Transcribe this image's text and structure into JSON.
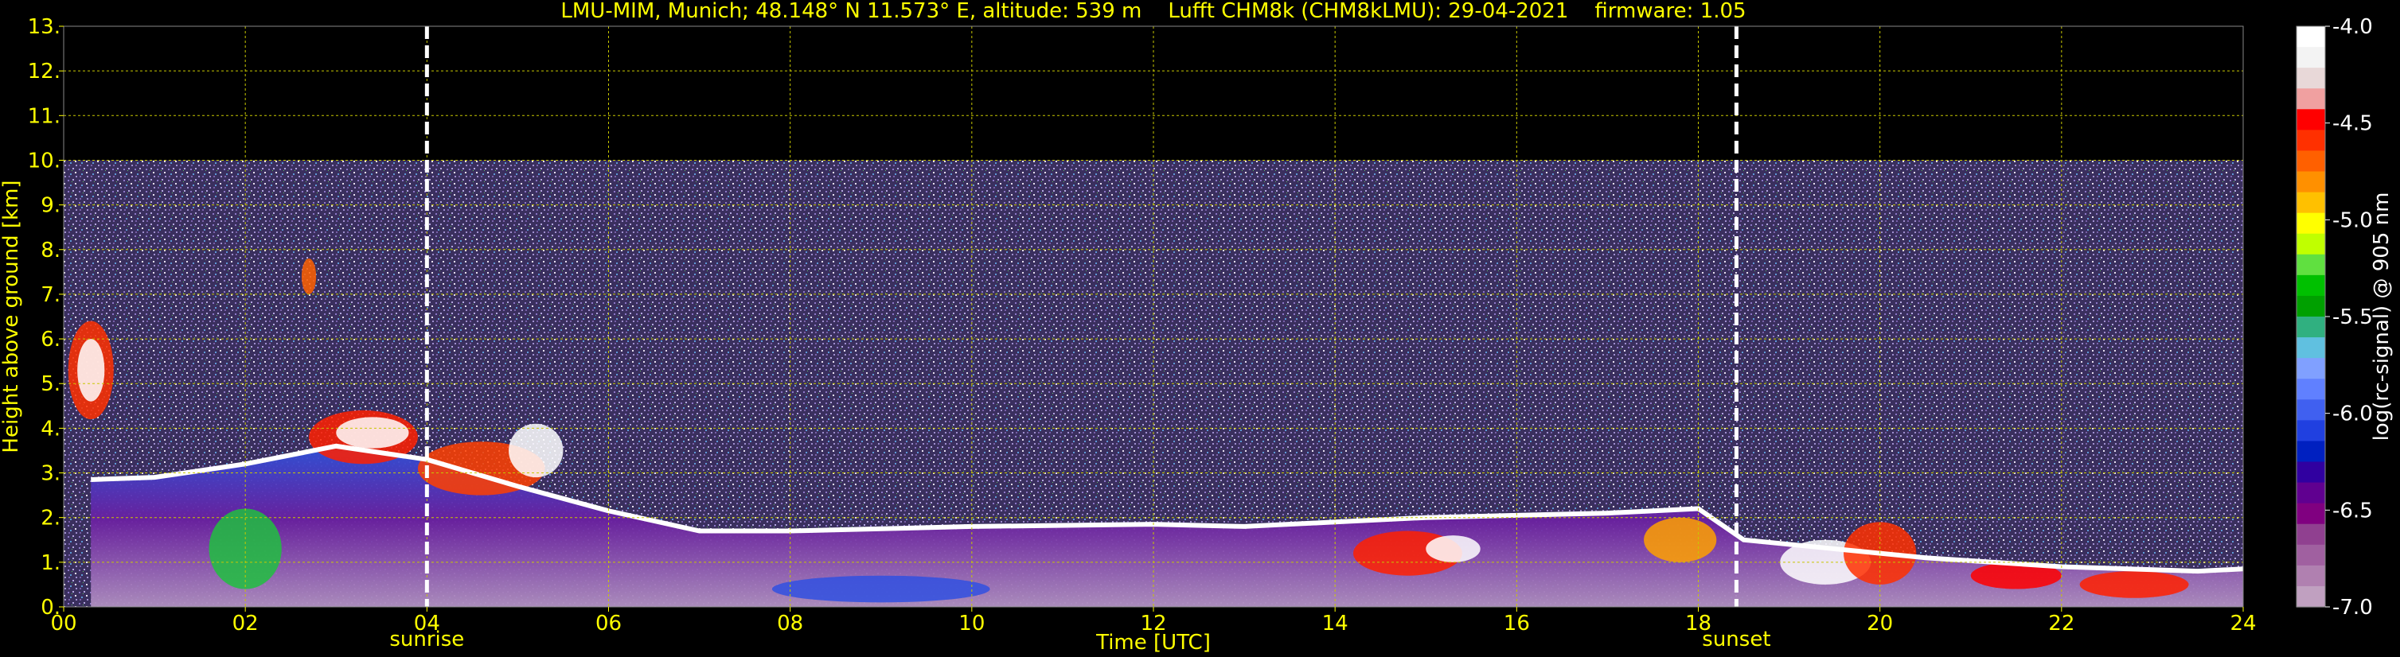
{
  "chart_data": {
    "type": "heatmap",
    "title": "LMU-MIM, Munich; 48.148° N 11.573° E, altitude: 539 m    Lufft CHM8k (CHM8kLMU): 29-04-2021    firmware: 1.05",
    "xlabel": "Time [UTC]",
    "ylabel": "Height above ground [km]",
    "xlim": [
      0,
      24
    ],
    "ylim": [
      0,
      13
    ],
    "x_ticks": [
      "00",
      "02",
      "04",
      "06",
      "08",
      "10",
      "12",
      "14",
      "16",
      "18",
      "20",
      "22",
      "24"
    ],
    "y_ticks": [
      "0.",
      "1.",
      "2.",
      "3.",
      "4.",
      "5.",
      "6.",
      "7.",
      "8.",
      "9.",
      "10.",
      "11.",
      "12.",
      "13."
    ],
    "grid": true,
    "signal_top_km": 10,
    "markers": [
      {
        "label": "sunrise",
        "time_utc": 4.0
      },
      {
        "label": "sunset",
        "time_utc": 18.42
      }
    ],
    "boundary_layer_km": [
      [
        0.3,
        2.85
      ],
      [
        1.0,
        2.9
      ],
      [
        2.0,
        3.2
      ],
      [
        3.0,
        3.6
      ],
      [
        4.0,
        3.3
      ],
      [
        5.0,
        2.7
      ],
      [
        6.0,
        2.15
      ],
      [
        7.0,
        1.7
      ],
      [
        8.0,
        1.7
      ],
      [
        10.0,
        1.8
      ],
      [
        12.0,
        1.85
      ],
      [
        13.0,
        1.8
      ],
      [
        14.0,
        1.9
      ],
      [
        15.0,
        2.0
      ],
      [
        16.0,
        2.05
      ],
      [
        17.0,
        2.1
      ],
      [
        18.0,
        2.2
      ],
      [
        18.5,
        1.5
      ],
      [
        19.5,
        1.3
      ],
      [
        20.5,
        1.1
      ],
      [
        22.0,
        0.9
      ],
      [
        23.5,
        0.8
      ],
      [
        24.0,
        0.85
      ]
    ],
    "colorbar": {
      "label": "log(rc-signal) @ 905 nm",
      "range": [
        -7.0,
        -4.0
      ],
      "ticks": [
        "-4.0",
        "-4.5",
        "-5.0",
        "-5.5",
        "-6.0",
        "-6.5",
        "-7.0"
      ],
      "colors_top_to_bottom": [
        "#ffffff",
        "#f3f3f3",
        "#e8d8d8",
        "#f0a0a0",
        "#ff0000",
        "#ff3000",
        "#ff6000",
        "#ff9000",
        "#ffc000",
        "#ffff00",
        "#c0ff00",
        "#60e040",
        "#00c000",
        "#00a000",
        "#30b080",
        "#60c0e0",
        "#80a0ff",
        "#6080ff",
        "#4060f0",
        "#2040e0",
        "#0020c0",
        "#3000a0",
        "#600090",
        "#800080",
        "#904090",
        "#a060a0",
        "#b080b0",
        "#c0a0c0"
      ]
    }
  }
}
